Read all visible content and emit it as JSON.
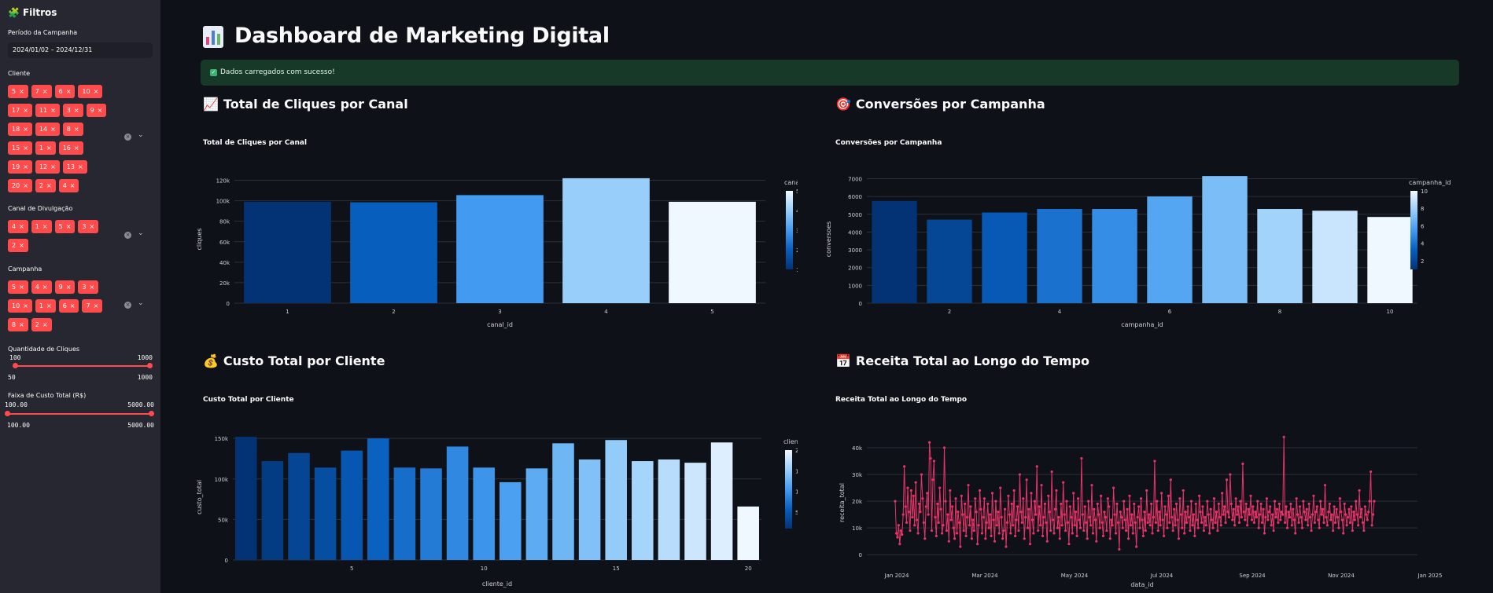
{
  "sidebar": {
    "title": "Filtros",
    "period_label": "Período da Campanha",
    "period_value": "2024/01/02 – 2024/12/31",
    "cliente_label": "Cliente",
    "cliente_rows": [
      [
        "5",
        "7",
        "6",
        "10"
      ],
      [
        "17",
        "11",
        "3",
        "9"
      ],
      [
        "18",
        "14",
        "8"
      ],
      [
        "15",
        "1",
        "16"
      ],
      [
        "19",
        "12",
        "13"
      ],
      [
        "20",
        "2",
        "4"
      ]
    ],
    "canal_label": "Canal de Divulgação",
    "canal_rows": [
      [
        "4",
        "1",
        "5",
        "3"
      ],
      [
        "2"
      ]
    ],
    "campanha_label": "Campanha",
    "campanha_rows": [
      [
        "5",
        "4",
        "9",
        "3"
      ],
      [
        "10",
        "1",
        "6",
        "7"
      ],
      [
        "8",
        "2"
      ]
    ],
    "tag_close": "×",
    "cliques_label": "Quantidade de Cliques",
    "cliques_sel_min": "100",
    "cliques_sel_max": "1000",
    "cliques_min": "50",
    "cliques_max": "1000",
    "custo_label": "Faixa de Custo Total (R$)",
    "custo_sel_min": "100.00",
    "custo_sel_max": "5000.00",
    "custo_min": "100.00",
    "custo_max": "5000.00"
  },
  "main": {
    "title": "Dashboard de Marketing Digital",
    "alert": "Dados carregados com sucesso!",
    "sections": {
      "cliques": "Total de Cliques por Canal",
      "conversoes": "Conversões por Campanha",
      "custo": "Custo Total por Cliente",
      "receita": "Receita Total ao Longo do Tempo"
    }
  },
  "colors": {
    "accent": "#ff4b4b",
    "success_bg": "#173928",
    "line": "#e8336a"
  },
  "chart_data": [
    {
      "type": "bar",
      "title": "Total de Cliques por Canal",
      "xlabel": "canal_id",
      "ylabel": "cliques",
      "categories": [
        1,
        2,
        3,
        4,
        5
      ],
      "values": [
        99000,
        98500,
        105500,
        122000,
        99000
      ],
      "ylim": [
        0,
        125000
      ],
      "yticks": [
        0,
        20000,
        40000,
        60000,
        80000,
        100000,
        120000
      ],
      "ytick_labels": [
        "0",
        "20k",
        "40k",
        "60k",
        "80k",
        "100k",
        "120k"
      ],
      "xtick_labels": [
        "1",
        "2",
        "3",
        "4",
        "5"
      ],
      "colorbar": {
        "title": "canal_id",
        "ticks": [
          "1",
          "2",
          "3",
          "4",
          "5"
        ]
      }
    },
    {
      "type": "bar",
      "title": "Conversões por Campanha",
      "xlabel": "campanha_id",
      "ylabel": "conversoes",
      "categories": [
        1,
        2,
        3,
        4,
        5,
        6,
        7,
        8,
        9,
        10
      ],
      "values": [
        5750,
        4700,
        5100,
        5300,
        5300,
        6000,
        7150,
        5300,
        5200,
        4850
      ],
      "ylim": [
        0,
        7200
      ],
      "yticks": [
        0,
        1000,
        2000,
        3000,
        4000,
        5000,
        6000,
        7000
      ],
      "ytick_labels": [
        "0",
        "1000",
        "2000",
        "3000",
        "4000",
        "5000",
        "6000",
        "7000"
      ],
      "xtick_labels": [
        "2",
        "4",
        "6",
        "8",
        "10"
      ],
      "colorbar": {
        "title": "campanha_id",
        "ticks": [
          "2",
          "4",
          "6",
          "8",
          "10"
        ]
      }
    },
    {
      "type": "bar",
      "title": "Custo Total por Cliente",
      "xlabel": "cliente_id",
      "ylabel": "custo_total",
      "categories": [
        1,
        2,
        3,
        4,
        5,
        6,
        7,
        8,
        9,
        10,
        11,
        12,
        13,
        14,
        15,
        16,
        17,
        18,
        19,
        20
      ],
      "values": [
        152000,
        122000,
        132000,
        114000,
        135000,
        150000,
        114000,
        113000,
        140000,
        114000,
        96000,
        113000,
        144000,
        124000,
        148000,
        122000,
        124000,
        120000,
        145000,
        66000
      ],
      "ylim": [
        0,
        155000
      ],
      "yticks": [
        0,
        50000,
        100000,
        150000
      ],
      "ytick_labels": [
        "0",
        "50k",
        "100k",
        "150k"
      ],
      "xtick_labels": [
        "5",
        "10",
        "15",
        "20"
      ],
      "colorbar": {
        "title": "cliente_id",
        "ticks": [
          "5",
          "10",
          "15",
          "20"
        ]
      }
    },
    {
      "type": "line",
      "title": "Receita Total ao Longo do Tempo",
      "xlabel": "data_id",
      "ylabel": "receita_total",
      "x_range": [
        "2024-01-02",
        "2024-12-31"
      ],
      "ylim": [
        -2000,
        45000
      ],
      "yticks": [
        0,
        10000,
        20000,
        30000,
        40000
      ],
      "ytick_labels": [
        "0",
        "10k",
        "20k",
        "30k",
        "40k"
      ],
      "xtick_labels": [
        "Jan 2024",
        "Mar 2024",
        "May 2024",
        "Jul 2024",
        "Sep 2024",
        "Nov 2024",
        "Jan 2025"
      ],
      "values": [
        20000,
        8000,
        6500,
        11000,
        4000,
        9000,
        7500,
        15000,
        33000,
        18000,
        12000,
        25000,
        16000,
        9000,
        24000,
        14000,
        22000,
        11000,
        27000,
        13000,
        8000,
        19000,
        16000,
        30000,
        21000,
        12000,
        6000,
        18000,
        23000,
        15000,
        42000,
        36000,
        9000,
        28000,
        35000,
        14000,
        7000,
        19000,
        12000,
        25000,
        17000,
        8000,
        11000,
        40000,
        20000,
        9000,
        15000,
        5000,
        24000,
        13000,
        18000,
        10000,
        6000,
        21000,
        8000,
        16000,
        12000,
        3000,
        22000,
        15000,
        9000,
        19000,
        7000,
        14000,
        26000,
        11000,
        18000,
        6000,
        13000,
        9000,
        21000,
        16000,
        4000,
        11000,
        24000,
        17000,
        8000,
        14000,
        21000,
        6000,
        12000,
        19000,
        10000,
        15000,
        7000,
        23000,
        13000,
        5000,
        20000,
        11000,
        16000,
        8000,
        25000,
        14000,
        6000,
        9000,
        17000,
        3000,
        12000,
        22000,
        15000,
        8000,
        19000,
        11000,
        24000,
        7000,
        13000,
        18000,
        9000,
        30000,
        16000,
        12000,
        21000,
        6000,
        14000,
        28000,
        10000,
        17000,
        4000,
        23000,
        13000,
        8000,
        20000,
        15000,
        33000,
        9000,
        18000,
        11000,
        26000,
        7000,
        14000,
        19000,
        12000,
        5000,
        22000,
        16000,
        9000,
        31000,
        13000,
        8000,
        17000,
        24000,
        10000,
        14000,
        6000,
        19000,
        11000,
        27000,
        15000,
        9000,
        20000,
        12000,
        4000,
        18000,
        14000,
        8000,
        23000,
        11000,
        16000,
        7000,
        21000,
        13000,
        10000,
        36000,
        15000,
        9000,
        18000,
        12000,
        6000,
        20000,
        14000,
        11000,
        26000,
        8000,
        17000,
        13000,
        5000,
        19000,
        15000,
        10000,
        22000,
        12000,
        7000,
        16000,
        14000,
        9000,
        21000,
        18000,
        6000,
        13000,
        11000,
        25000,
        15000,
        8000,
        19000,
        12000,
        2000,
        16000,
        14000,
        10000,
        20000,
        13000,
        9000,
        17000,
        6000,
        22000,
        11000,
        15000,
        8000,
        19000,
        12000,
        3000,
        14000,
        18000,
        10000,
        21000,
        13000,
        7000,
        16000,
        9000,
        24000,
        12000,
        15000,
        11000,
        19000,
        8000,
        14000,
        35000,
        12000,
        20000,
        9000,
        16000,
        11000,
        23000,
        13000,
        7000,
        18000,
        15000,
        10000,
        22000,
        12000,
        28000,
        14000,
        9000,
        17000,
        11000,
        19000,
        13000,
        6000,
        21000,
        15000,
        10000,
        24000,
        8000,
        16000,
        12000,
        18000,
        14000,
        9000,
        20000,
        11000,
        15000,
        7000,
        19000,
        13000,
        10000,
        22000,
        16000,
        12000,
        18000,
        9000,
        14000,
        11000,
        20000,
        15000,
        8000,
        17000,
        13000,
        10000,
        21000,
        12000,
        16000,
        9000,
        19000,
        14000,
        11000,
        23000,
        15000,
        18000,
        12000,
        28000,
        16000,
        14000,
        30000,
        19000,
        13000,
        17000,
        11000,
        21000,
        15000,
        18000,
        12000,
        20000,
        14000,
        34000,
        16000,
        13000,
        19000,
        11000,
        17000,
        15000,
        22000,
        13000,
        18000,
        12000,
        16000,
        14000,
        20000,
        10000,
        15000,
        19000,
        12000,
        17000,
        8000,
        14000,
        21000,
        13000,
        16000,
        18000,
        11000,
        15000,
        9000,
        20000,
        14000,
        17000,
        12000,
        19000,
        13000,
        16000,
        15000,
        44000,
        12000,
        18000,
        10000,
        16000,
        14000,
        19000,
        11000,
        17000,
        13000,
        8000,
        21000,
        15000,
        12000,
        18000,
        14000,
        10000,
        20000,
        16000,
        13000,
        17000,
        11000,
        19000,
        14000,
        9000,
        15000,
        22000,
        12000,
        16000,
        18000,
        13000,
        10000,
        20000,
        15000,
        17000,
        12000,
        26000,
        14000,
        11000,
        16000,
        19000,
        13000,
        15000,
        9000,
        18000,
        12000,
        17000,
        14000,
        10000,
        21000,
        16000,
        13000,
        8000,
        19000,
        15000,
        11000,
        14000,
        17000,
        12000,
        18000,
        9000,
        16000,
        13000,
        20000,
        15000,
        11000,
        24000,
        14000,
        17000,
        12000,
        9000,
        18000,
        15000,
        13000,
        16000,
        20000,
        31000,
        11000,
        15000,
        20000
      ]
    }
  ]
}
